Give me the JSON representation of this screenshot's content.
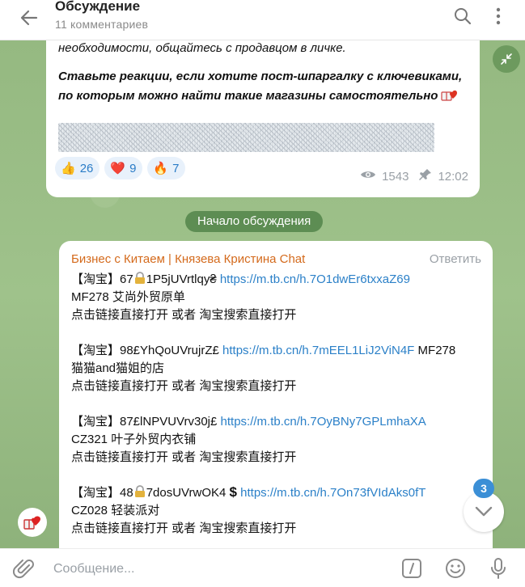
{
  "header": {
    "title": "Обсуждение",
    "subtitle": "11 комментариев"
  },
  "post": {
    "line1": "необходимости, общайтесь с продавцом в личке.",
    "line2": "Ставьте реакции, если хотите пост-шпаргалку с ключевиками,",
    "line3": "по которым можно найти такие магазины самостоятельно",
    "reactions": [
      {
        "emoji": "👍",
        "count": "26"
      },
      {
        "emoji": "❤️",
        "count": "9"
      },
      {
        "emoji": "🔥",
        "count": "7"
      }
    ],
    "views": "1543",
    "time": "12:02"
  },
  "discussion_start": "Начало обсуждения",
  "comment": {
    "sender": "Бизнес с Китаем | Князева Кристина Chat",
    "reply_label": "Ответить",
    "items": [
      {
        "prefix": "【淘宝】67",
        "code": "1P5jUVrtlqy₴",
        "link": "https://m.tb.cn/h.7O1dwEr6txxaZ69",
        "line2": "MF278 艾尚外贸原单",
        "line3": "点击链接直接打开 或者 淘宝搜索直接打开"
      },
      {
        "prefix": "【淘宝】98£YhQoUVrujrZ£",
        "link": "https://m.tb.cn/h.7mEEL1LiJ2ViN4F",
        "suffix": "MF278",
        "line2": "猫猫and猫姐的店",
        "line3": "点击链接直接打开 或者 淘宝搜索直接打开"
      },
      {
        "prefix": "【淘宝】87£lNPVUVrv30j£",
        "link": "https://m.tb.cn/h.7OyBNy7GPLmhaXA",
        "line2": "CZ321 叶子外贸内衣铺",
        "line3": "点击链接直接打开 或者 淘宝搜索直接打开"
      },
      {
        "prefix": "【淘宝】48",
        "code": "7dosUVrwOK4",
        "dollar": "$",
        "link": "https://m.tb.cn/h.7On73fVIdAks0fT",
        "line2": "CZ028 轻装派对",
        "line3": "点击链接直接打开 或者 淘宝搜索直接打开"
      }
    ]
  },
  "unread_count": "3",
  "composer": {
    "placeholder": "Сообщение..."
  }
}
